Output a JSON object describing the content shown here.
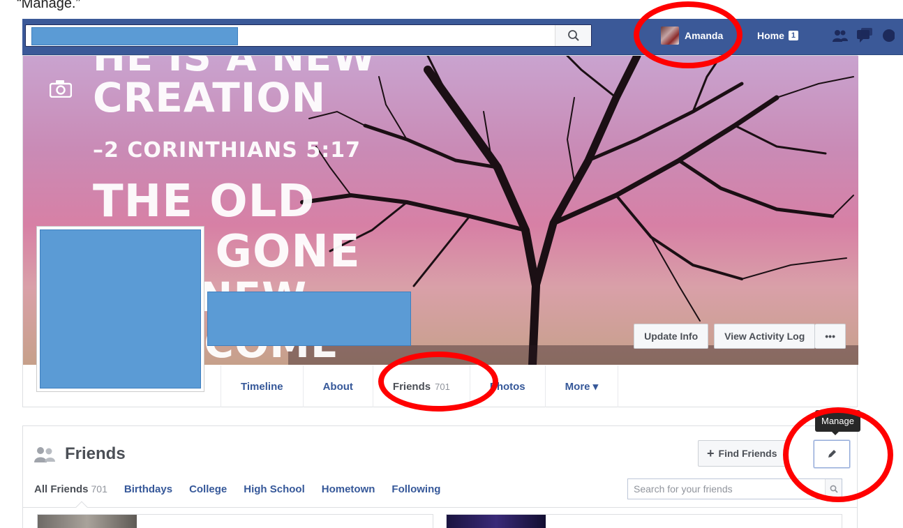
{
  "caption": "“Manage.”",
  "topbar": {
    "search_icon": "search-icon",
    "user_name": "Amanda",
    "home_label": "Home",
    "home_count": "1"
  },
  "cover": {
    "lines": [
      "HE IS A NEW",
      "CREATION",
      "–2 CORINTHIANS 5:17",
      "THE OLD",
      "HAS GONE",
      "THE NEW",
      "HAS COME"
    ],
    "update_info_label": "Update Info",
    "activity_log_label": "View Activity Log",
    "more_dots_label": "•••"
  },
  "tabs": [
    {
      "label": "Timeline",
      "count": ""
    },
    {
      "label": "About",
      "count": ""
    },
    {
      "label": "Friends",
      "count": "701"
    },
    {
      "label": "Photos",
      "count": ""
    },
    {
      "label": "More ▾",
      "count": ""
    }
  ],
  "friends": {
    "title": "Friends",
    "find_friends_label": "Find Friends",
    "tooltip": "Manage",
    "subtabs": [
      {
        "label": "All Friends",
        "count": "701"
      },
      {
        "label": "Birthdays",
        "count": ""
      },
      {
        "label": "College",
        "count": ""
      },
      {
        "label": "High School",
        "count": ""
      },
      {
        "label": "Hometown",
        "count": ""
      },
      {
        "label": "Following",
        "count": ""
      }
    ],
    "search_placeholder": "Search for your friends"
  },
  "colors": {
    "brand": "#3b5998",
    "link": "#365899",
    "redaction": "#5b9bd5",
    "annotation": "#ff0000"
  }
}
